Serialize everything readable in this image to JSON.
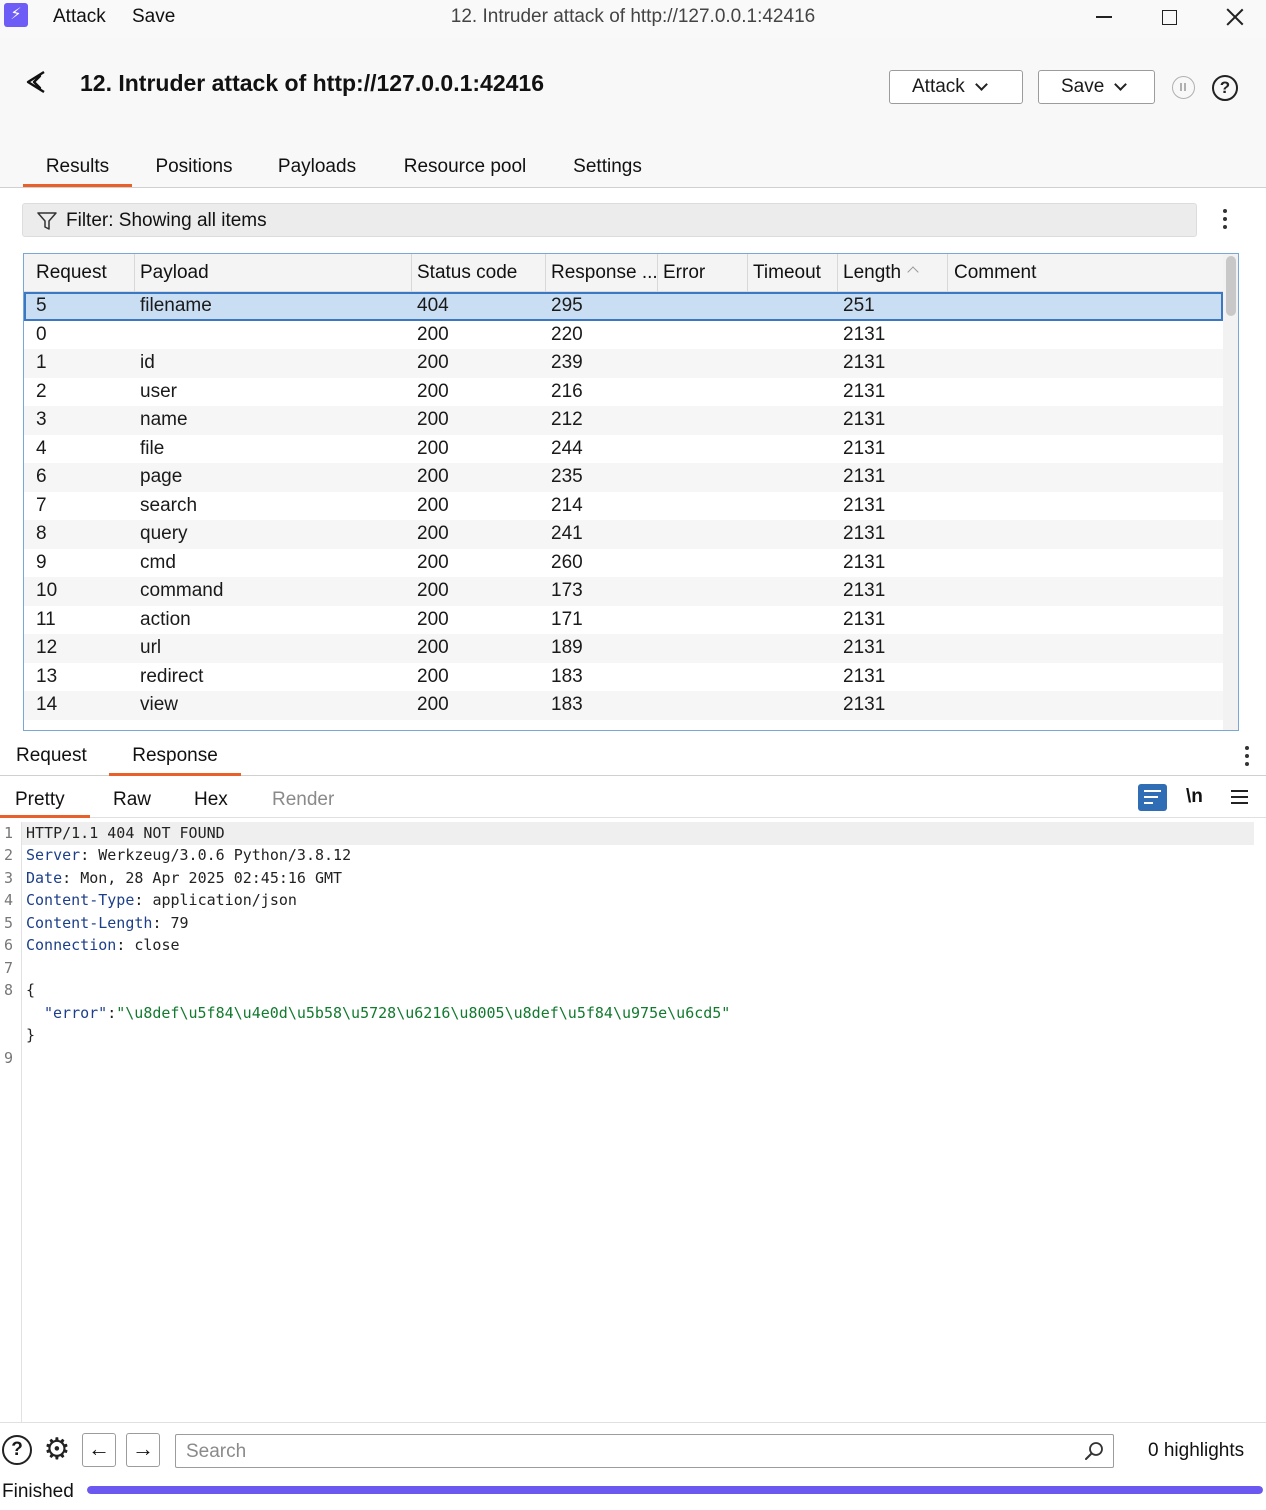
{
  "window": {
    "menu": [
      "Attack",
      "Save"
    ],
    "title": "12. Intruder attack of http://127.0.0.1:42416"
  },
  "header": {
    "title": "12. Intruder attack of http://127.0.0.1:42416",
    "attack_label": "Attack",
    "save_label": "Save",
    "help_glyph": "?"
  },
  "tabs": [
    "Results",
    "Positions",
    "Payloads",
    "Resource pool",
    "Settings"
  ],
  "filter": {
    "label": "Filter: Showing all items"
  },
  "table": {
    "columns": [
      "Request",
      "Payload",
      "Status code",
      "Response ...",
      "Error",
      "Timeout",
      "Length",
      "Comment"
    ],
    "sort_column": "Length",
    "rows": [
      [
        "5",
        "filename",
        "404",
        "295",
        "",
        "",
        "251",
        ""
      ],
      [
        "0",
        "",
        "200",
        "220",
        "",
        "",
        "2131",
        ""
      ],
      [
        "1",
        "id",
        "200",
        "239",
        "",
        "",
        "2131",
        ""
      ],
      [
        "2",
        "user",
        "200",
        "216",
        "",
        "",
        "2131",
        ""
      ],
      [
        "3",
        "name",
        "200",
        "212",
        "",
        "",
        "2131",
        ""
      ],
      [
        "4",
        "file",
        "200",
        "244",
        "",
        "",
        "2131",
        ""
      ],
      [
        "6",
        "page",
        "200",
        "235",
        "",
        "",
        "2131",
        ""
      ],
      [
        "7",
        "search",
        "200",
        "214",
        "",
        "",
        "2131",
        ""
      ],
      [
        "8",
        "query",
        "200",
        "241",
        "",
        "",
        "2131",
        ""
      ],
      [
        "9",
        "cmd",
        "200",
        "260",
        "",
        "",
        "2131",
        ""
      ],
      [
        "10",
        "command",
        "200",
        "173",
        "",
        "",
        "2131",
        ""
      ],
      [
        "11",
        "action",
        "200",
        "171",
        "",
        "",
        "2131",
        ""
      ],
      [
        "12",
        "url",
        "200",
        "189",
        "",
        "",
        "2131",
        ""
      ],
      [
        "13",
        "redirect",
        "200",
        "183",
        "",
        "",
        "2131",
        ""
      ],
      [
        "14",
        "view",
        "200",
        "183",
        "",
        "",
        "2131",
        ""
      ]
    ],
    "selected_row": 0
  },
  "message_tabs": [
    "Request",
    "Response"
  ],
  "view_tabs": [
    "Pretty",
    "Raw",
    "Hex",
    "Render"
  ],
  "newline_label": "\\n",
  "response": {
    "line_numbers": [
      "1",
      "2",
      "3",
      "4",
      "5",
      "6",
      "7",
      "8",
      "9"
    ],
    "status_line": "HTTP/1.1 404 NOT FOUND",
    "headers": [
      {
        "name": "Server",
        "value": "Werkzeug/3.0.6 Python/3.8.12"
      },
      {
        "name": "Date",
        "value": "Mon, 28 Apr 2025 02:45:16 GMT"
      },
      {
        "name": "Content-Type",
        "value": "application/json"
      },
      {
        "name": "Content-Length",
        "value": "79"
      },
      {
        "name": "Connection",
        "value": "close"
      }
    ],
    "body_open": "{",
    "body_key": "\"error\"",
    "body_value": "\"\\u8def\\u5f84\\u4e0d\\u5b58\\u5728\\u6216\\u8005\\u8def\\u5f84\\u975e\\u6cd5\"",
    "body_close": "}"
  },
  "bottom": {
    "search_placeholder": "Search",
    "highlights": "0 highlights"
  },
  "status": {
    "text": "Finished",
    "progress": 1.0
  },
  "colors": {
    "accent_tab": "#e8602a",
    "selection": "#c9ddf3",
    "progress": "#6a58f0"
  }
}
